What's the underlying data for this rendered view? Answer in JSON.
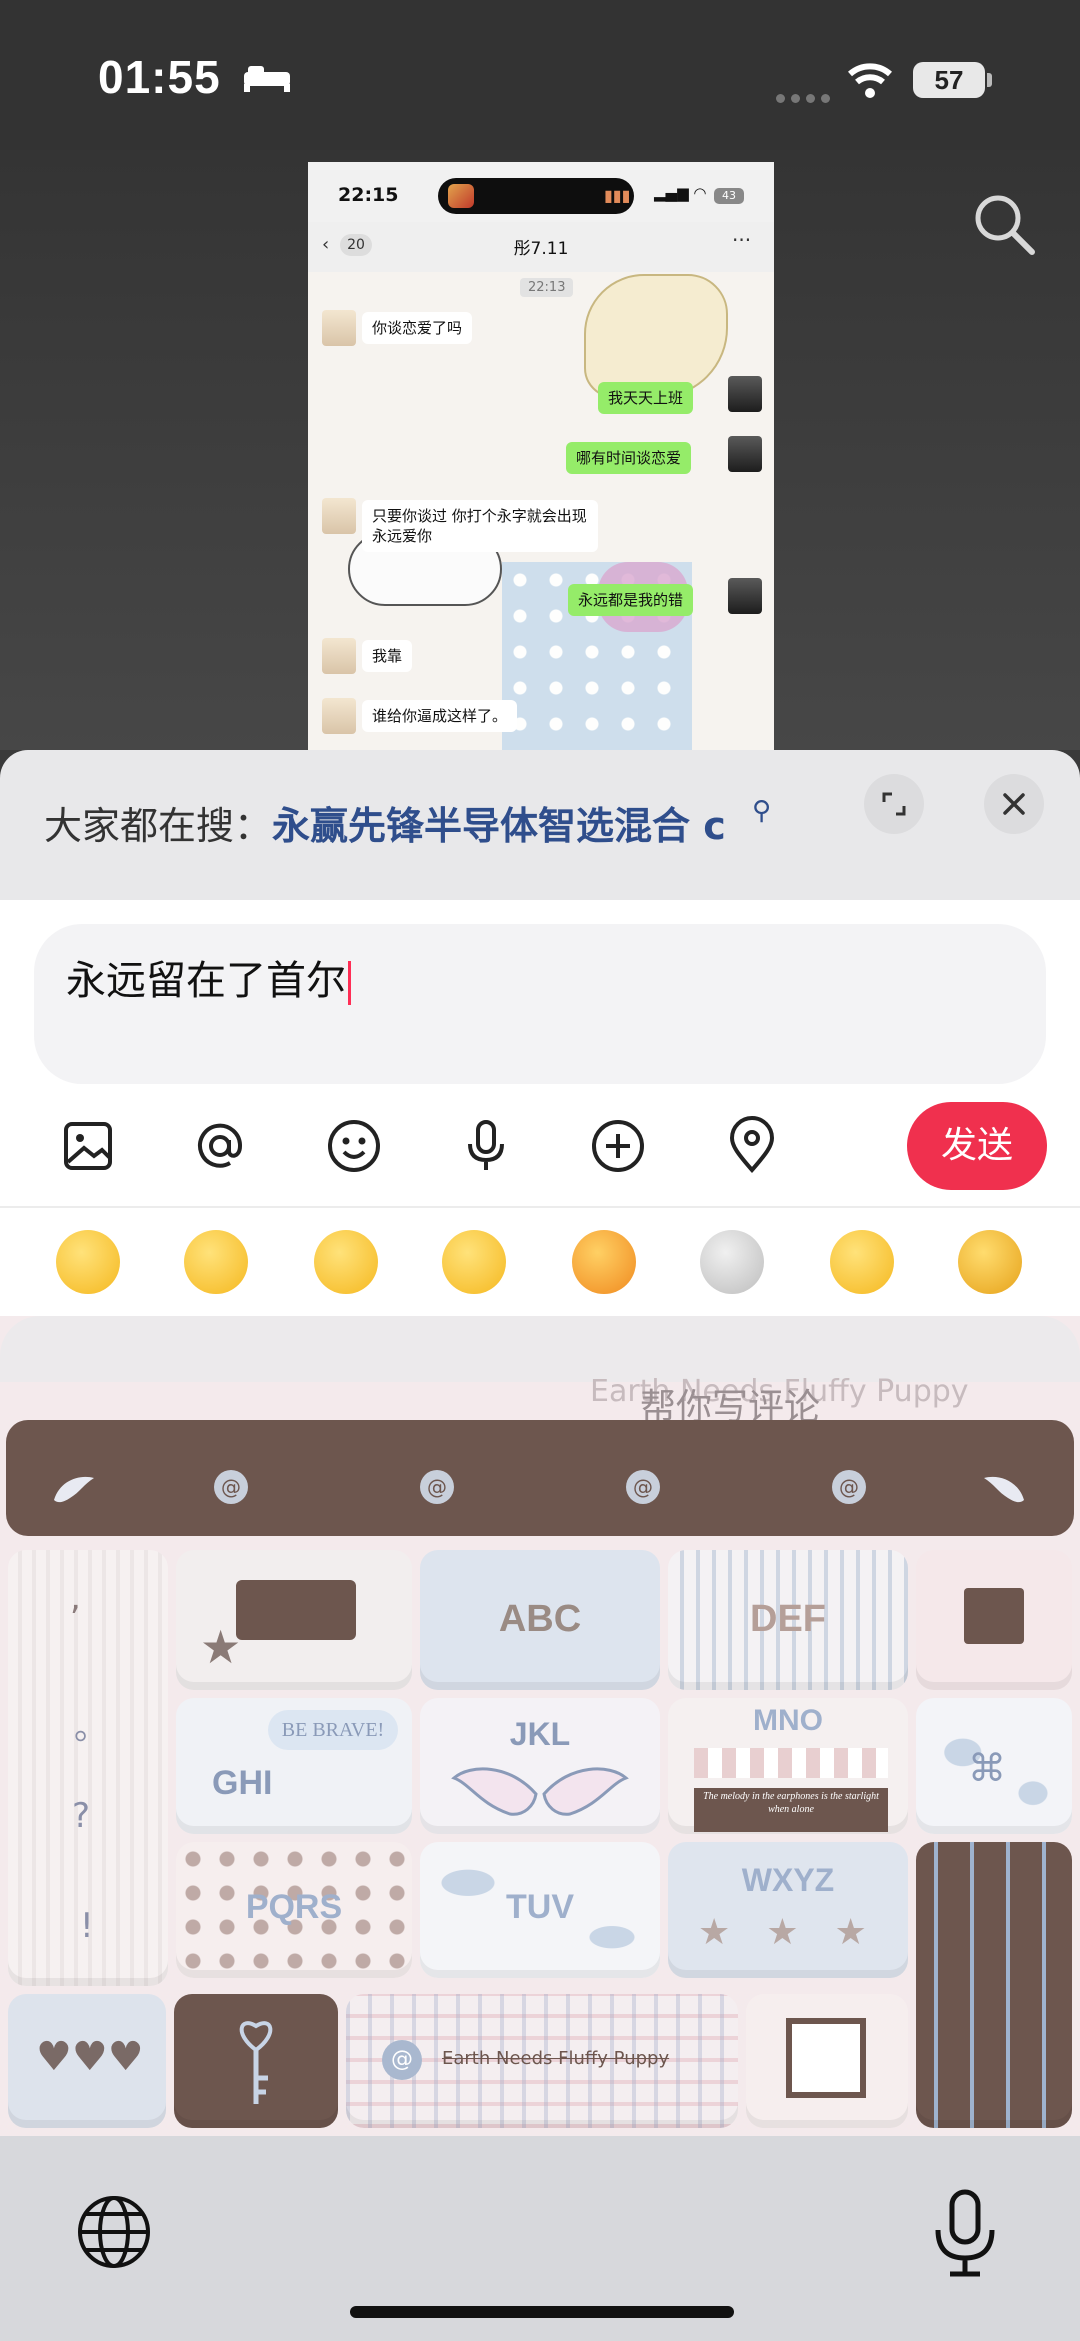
{
  "status_bar": {
    "time": "01:55",
    "battery": "57"
  },
  "preview": {
    "time": "22:15",
    "battery": "43",
    "back_count": "20",
    "chat_title": "彤7.11",
    "more": "···",
    "stamp": "22:13",
    "messages": [
      {
        "side": "left",
        "text": "你谈恋爱了吗"
      },
      {
        "side": "right",
        "text": "我天天上班"
      },
      {
        "side": "right",
        "text": "哪有时间谈恋爱"
      },
      {
        "side": "left",
        "text": "只要你谈过 你打个永字就会出现永远爱你"
      },
      {
        "side": "right",
        "text": "永远都是我的错"
      },
      {
        "side": "left",
        "text": "我靠"
      },
      {
        "side": "left",
        "text": "谁给你逼成这样了。"
      }
    ]
  },
  "hot_search": {
    "label": "大家都在搜：",
    "query": "永赢先锋半导体智选混合 c"
  },
  "editor": {
    "text": "永远留在了首尔"
  },
  "toolbar": {
    "send_label": "发送"
  },
  "keyboard": {
    "banner": "帮你写评论",
    "banner_faint": "Earth Needs Fluffy Puppy",
    "keys_row1": [
      "ABC",
      "DEF"
    ],
    "keys_row2": [
      "GHI",
      "JKL",
      "MNO"
    ],
    "keys_row3": [
      "PQRS",
      "TUV",
      "WXYZ"
    ],
    "sticker_text1": "BE BRAVE!",
    "sticker_text2": "The melody in the earphones is the starlight when alone",
    "space_text": "Earth Needs Fluffy Puppy",
    "side_punct": [
      ",",
      "。",
      "?",
      "!"
    ]
  },
  "colors": {
    "send": "#f0304e",
    "hot_query": "#2f4e8c",
    "brown": "#6d564e"
  }
}
